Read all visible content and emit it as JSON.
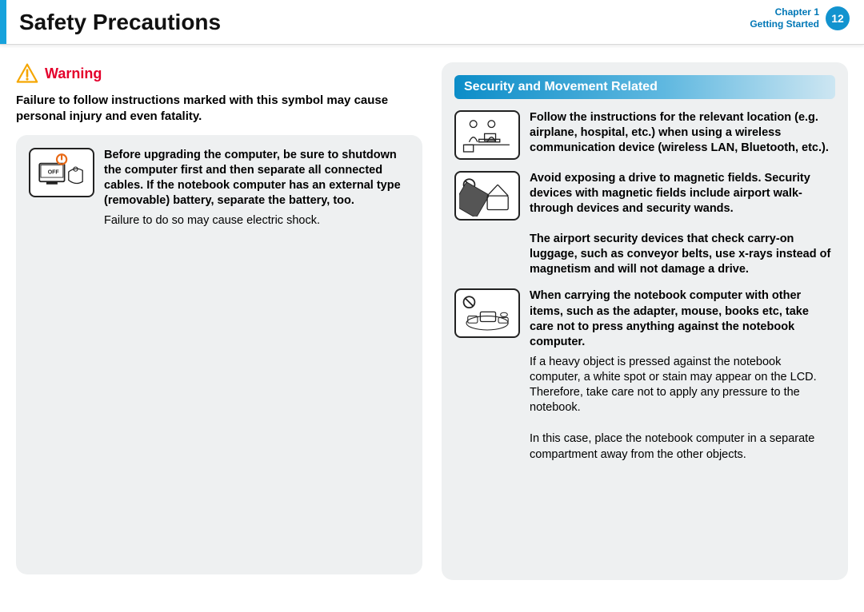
{
  "header": {
    "title": "Safety Precautions",
    "chapter_label": "Chapter 1",
    "section_label": "Getting Started",
    "page_number": "12"
  },
  "warning": {
    "label": "Warning",
    "description": "Failure to follow instructions marked with this symbol may cause personal injury and even fatality."
  },
  "left_panel": {
    "items": [
      {
        "bold": "Before upgrading the computer, be sure to shutdown the computer first and then separate all connected cables. If the notebook computer has an external type (removable) battery, separate the battery, too.",
        "plain": "Failure to do so may cause electric shock."
      }
    ]
  },
  "right_panel": {
    "section_title": "Security and Movement Related",
    "items": [
      {
        "bold": "Follow the instructions for the relevant location (e.g. airplane, hospital, etc.) when using a wireless communication device (wireless LAN, Bluetooth, etc.).",
        "plain": ""
      },
      {
        "bold": "Avoid exposing a drive to magnetic fields. Security devices with magnetic fields include airport walk-through devices and security wands.",
        "plain": ""
      },
      {
        "bold": "The airport security devices that check carry-on luggage, such as conveyor belts, use x-rays instead of magnetism and will not damage a drive.",
        "plain": "",
        "no_thumb": true
      },
      {
        "bold": "When carrying the notebook computer with other items, such as the adapter, mouse, books etc, take care not to press anything against the notebook computer.",
        "plain": "If a heavy object is pressed against the notebook computer, a white spot or stain may appear on the LCD. Therefore, take care not to apply any pressure to the notebook."
      },
      {
        "bold": "",
        "plain": "In this case, place the notebook computer in a separate compartment away from the other objects.",
        "no_thumb": true
      }
    ]
  }
}
